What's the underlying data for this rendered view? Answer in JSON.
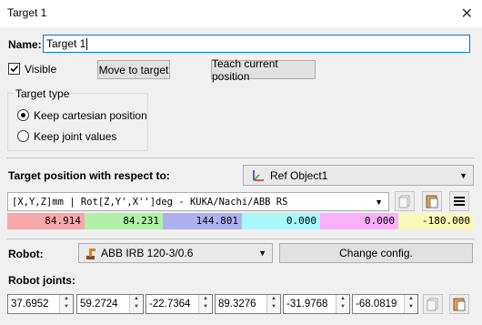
{
  "window": {
    "title": "Target 1",
    "close_glyph": "✕"
  },
  "name": {
    "label": "Name:",
    "value": "Target 1"
  },
  "visible": {
    "label": "Visible",
    "checked": true
  },
  "buttons": {
    "move": "Move to target",
    "teach": "Teach current position",
    "change_config": "Change config."
  },
  "target_type": {
    "title": "Target type",
    "options": [
      {
        "label": "Keep cartesian position",
        "selected": true
      },
      {
        "label": "Keep joint values",
        "selected": false
      }
    ]
  },
  "reference": {
    "label": "Target position with respect to:",
    "value": "Ref Object1",
    "icon": "reference-frame-icon"
  },
  "format": {
    "value": "[X,Y,Z]mm | Rot[Z,Y',X'']deg - KUKA/Nachi/ABB RS"
  },
  "pose_values": [
    {
      "value": "84.914",
      "color": "#f8a8a8"
    },
    {
      "value": "84.231",
      "color": "#b0f0a8"
    },
    {
      "value": "144.801",
      "color": "#b0b0f0"
    },
    {
      "value": "0.000",
      "color": "#a8f8f8"
    },
    {
      "value": "0.000",
      "color": "#f8b0f8"
    },
    {
      "value": "-180.000",
      "color": "#f8f8b8"
    }
  ],
  "robot": {
    "label": "Robot:",
    "value": "ABB IRB 120-3/0.6",
    "icon": "robot-arm-icon"
  },
  "joints": {
    "label": "Robot joints:",
    "values": [
      "37.6952",
      "59.2724",
      "-22.7364",
      "89.3276",
      "-31.9768",
      "-68.0819"
    ]
  },
  "icons": {
    "copy": "copy-icon",
    "paste": "paste-icon",
    "menu": "hamburger-menu-icon"
  }
}
